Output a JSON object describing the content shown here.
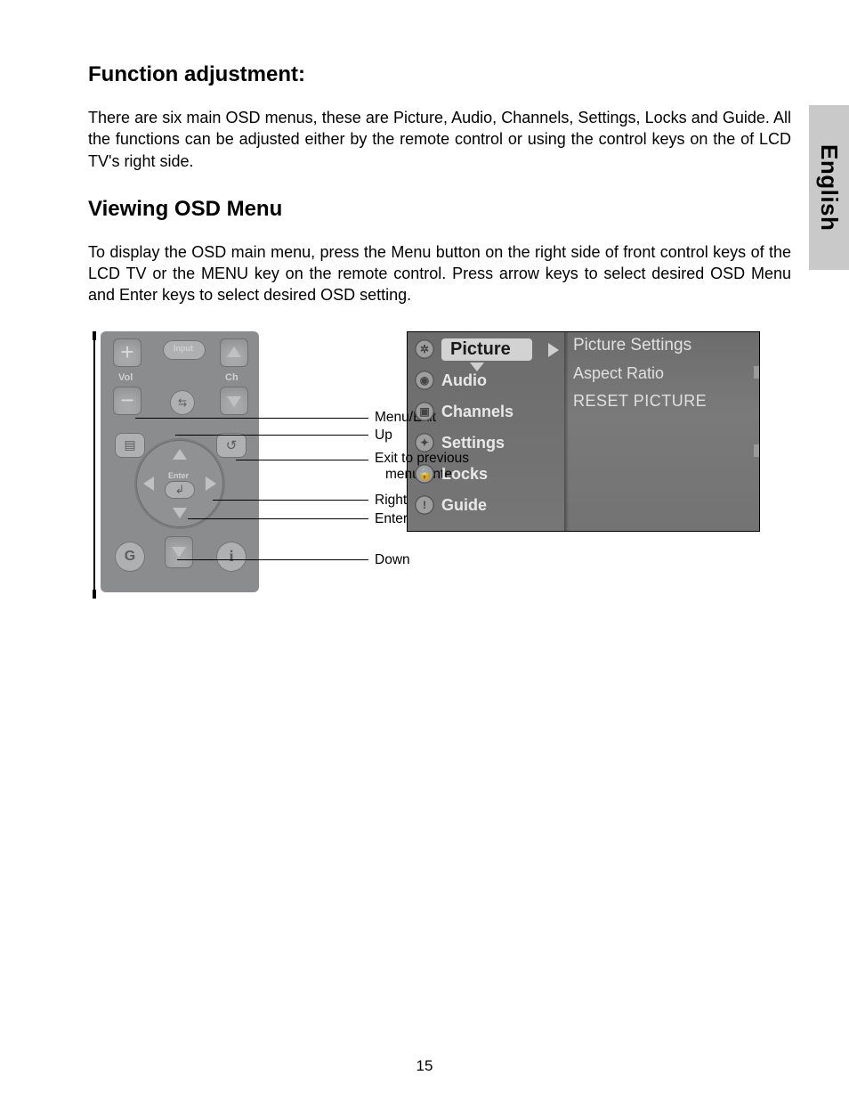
{
  "sideTab": "English",
  "heading1": "Function adjustment:",
  "para1": "There are six main OSD menus, these are Picture, Audio, Channels, Settings, Locks and Guide. All the functions can be adjusted either by the remote control or using the control keys on the of LCD TV's right side.",
  "heading2": "Viewing OSD Menu",
  "para2": "To display the OSD main menu, press the Menu button on the right side of front control keys of the LCD TV or the MENU key on the remote control. Press arrow keys to select desired OSD Menu and Enter keys to select desired OSD setting.",
  "remote": {
    "vol": "Vol",
    "ch": "Ch",
    "input": "Input",
    "enter": "Enter",
    "g": "G",
    "i": "i"
  },
  "callouts": {
    "menuExit": "Menu/Exit",
    "up": "Up",
    "exitPrev1": "Exit to previous",
    "exitPrev2": "menu/Enter",
    "right": "Right",
    "enter": "Enter",
    "down": "Down"
  },
  "osd": {
    "menu": {
      "picture": "Picture",
      "audio": "Audio",
      "channels": "Channels",
      "settings": "Settings",
      "locks": "Locks",
      "guide": "Guide"
    },
    "sub": {
      "pictureSettings": "Picture Settings",
      "aspectRatio": "Aspect Ratio",
      "resetPicture": "RESET PICTURE"
    }
  },
  "pageNumber": "15"
}
